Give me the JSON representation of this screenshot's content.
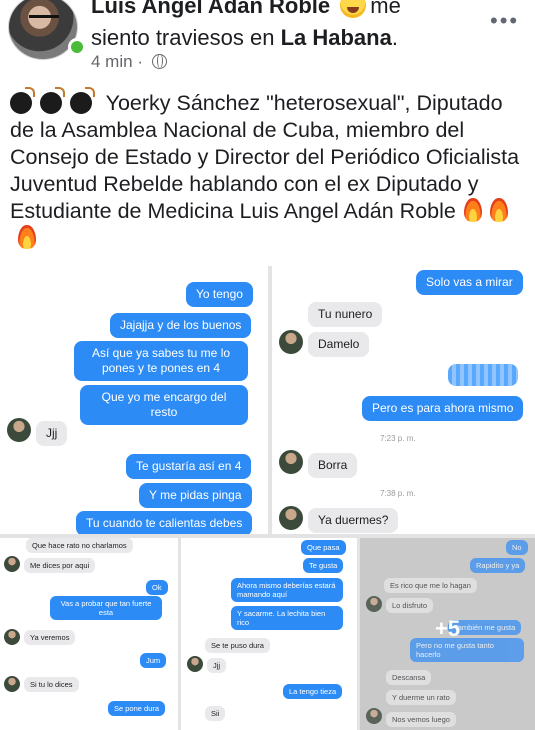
{
  "post": {
    "author": "Luis Angel Adan Roble",
    "feeling_text": "me",
    "feeling_line2": "siento traviesos en",
    "location": "La Habana",
    "location_suffix": ".",
    "time": "4 min",
    "dot": "·",
    "more": "•••",
    "body": "Yoerky Sánchez \"heterosexual\", Diputado de la Asamblea Nacional de Cuba, miembro del Consejo de Estado y Director del Periódico Oficialista Juventud Rebelde hablando con el ex Diputado y Estudiante de Medicina Luis Angel Adán Roble"
  },
  "icons": {
    "avatar": "profile-photo",
    "feeling": "grinning-squinting-face-emoji",
    "privacy": "globe-icon",
    "prefix": "bomb-emoji",
    "suffix": "fire-emoji"
  },
  "colors": {
    "sent": "#2d8bf6",
    "received": "#e9e9eb",
    "online": "#4bbb3a"
  },
  "chat_left": [
    {
      "from": "me",
      "text": "Yo tengo"
    },
    {
      "from": "me",
      "text": "Jajajja y de los buenos"
    },
    {
      "from": "me",
      "text": "Así que ya sabes tu me lo pones y te pones en 4"
    },
    {
      "from": "me",
      "text": "Que yo me encargo del resto"
    },
    {
      "from": "them",
      "text": "Jjj"
    },
    {
      "from": "me",
      "text": "Te gustaría así en 4"
    },
    {
      "from": "me",
      "text": "Y me pidas pinga"
    },
    {
      "from": "me",
      "text": "Tu cuando te calientas debes"
    }
  ],
  "chat_right": [
    {
      "from": "me",
      "text": "Solo vas a mirar"
    },
    {
      "from": "them",
      "text": "Tu nunero"
    },
    {
      "from": "them",
      "text": "Damelo"
    },
    {
      "from": "me",
      "text": ""
    },
    {
      "from": "me",
      "text": "Pero es para ahora mismo"
    },
    {
      "from": "time",
      "text": "7:23 p. m."
    },
    {
      "from": "them",
      "text": "Borra"
    },
    {
      "from": "time",
      "text": "7:38 p. m."
    },
    {
      "from": "them",
      "text": "Ya duermes?"
    }
  ],
  "chat_bottom_left": [
    {
      "from": "them",
      "text": "Que hace rato no charlamos"
    },
    {
      "from": "them",
      "text": "Me dices por aqui"
    },
    {
      "from": "me",
      "text": "Ok"
    },
    {
      "from": "me",
      "text": "Vas a probar que tan fuerte esta"
    },
    {
      "from": "them",
      "text": "Ya veremos"
    },
    {
      "from": "me",
      "text": "Jum"
    },
    {
      "from": "them",
      "text": "Si tu lo dices"
    },
    {
      "from": "me",
      "text": "Se pone dura"
    }
  ],
  "chat_bottom_middle": [
    {
      "from": "me",
      "text": "Que pasa"
    },
    {
      "from": "me",
      "text": "Te gusta"
    },
    {
      "from": "me",
      "text": "Ahora mismo deberías estará mamando aquí"
    },
    {
      "from": "me",
      "text": "Y sacarme. La lechita bien rico"
    },
    {
      "from": "them",
      "text": "Se te puso dura"
    },
    {
      "from": "them",
      "text": "Jjj"
    },
    {
      "from": "me",
      "text": "La tengo tieza"
    },
    {
      "from": "them",
      "text": "Sii"
    }
  ],
  "chat_bottom_right": [
    {
      "from": "me",
      "text": "No"
    },
    {
      "from": "me",
      "text": "Rapidito y ya"
    },
    {
      "from": "them",
      "text": "Es rico que me lo hagan"
    },
    {
      "from": "them",
      "text": "Lo disfruto"
    },
    {
      "from": "me",
      "text": "También me gusta"
    },
    {
      "from": "me",
      "text": "Pero no me gusta tanto hacerlo"
    },
    {
      "from": "them",
      "text": "Descansa"
    },
    {
      "from": "them",
      "text": "Y duerme un rato"
    },
    {
      "from": "them",
      "text": "Nos vemos luego"
    }
  ],
  "more_photos": "+5"
}
